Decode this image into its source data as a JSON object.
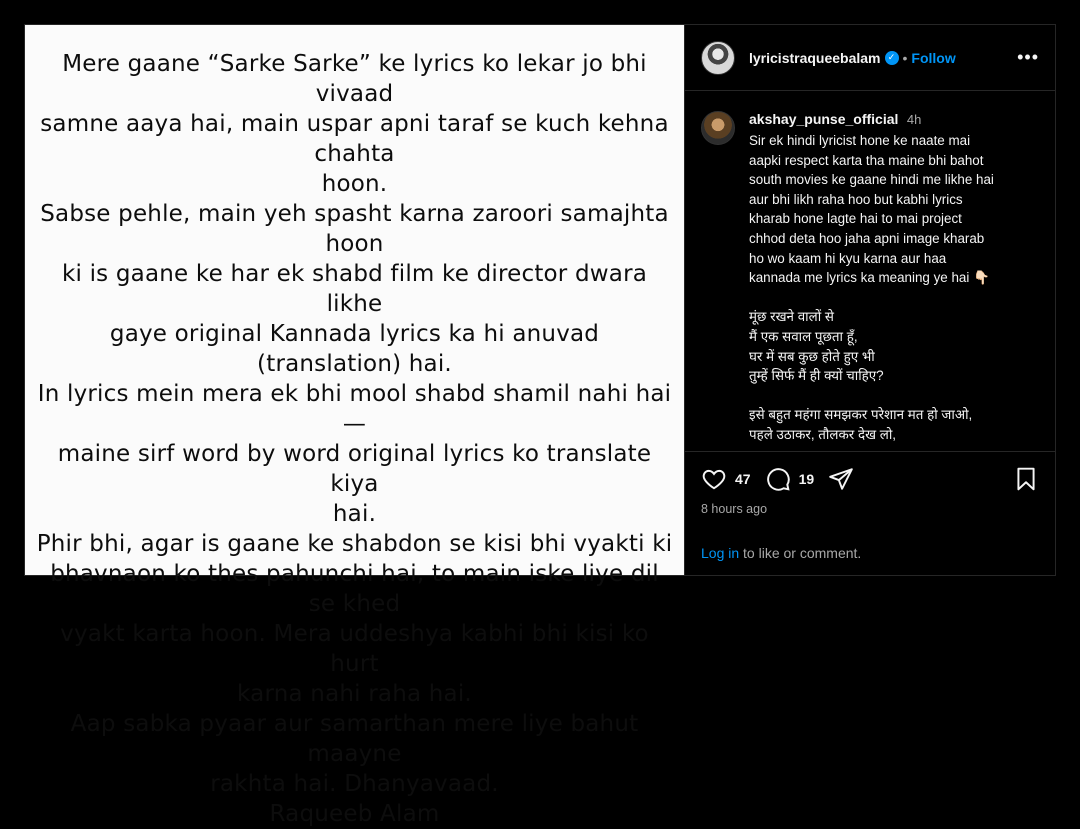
{
  "image_text": {
    "lines": [
      "Mere gaane “Sarke Sarke” ke lyrics ko lekar jo bhi vivaad",
      "samne aaya hai, main uspar apni taraf se kuch kehna chahta",
      "hoon.",
      "Sabse pehle, main yeh spasht karna zaroori samajhta hoon",
      "ki is gaane ke har ek shabd film ke director dwara likhe",
      "gaye original Kannada lyrics ka hi anuvad (translation) hai.",
      "In lyrics mein mera ek bhi mool shabd shamil nahi hai —",
      "maine sirf word by word original lyrics ko translate kiya",
      "hai.",
      "Phir bhi, agar is gaane ke shabdon se kisi bhi vyakti ki",
      "bhavnaon ko thes pahunchi hai, to main iske liye dil se khed",
      "vyakt karta hoon. Mera uddeshya kabhi bhi kisi ko hurt",
      "karna nahi raha hai.",
      "Aap sabka pyaar aur samarthan mere liye bahut maayne",
      "rakhta hai. Dhanyavaad.",
      "Raqueeb Alam"
    ]
  },
  "header": {
    "username": "lyricistraqueebalam",
    "dot": "•",
    "follow_label": "Follow",
    "more_label": "•••"
  },
  "comment": {
    "username": "akshay_punse_official",
    "time": "4h",
    "lines": [
      "Sir ek hindi lyricist hone ke naate mai",
      "aapki respect karta tha maine bhi bahot",
      "south movies ke gaane hindi me likhe hai",
      "aur bhi likh raha hoo but kabhi lyrics",
      "kharab hone lagte hai to mai project",
      "chhod deta hoo jaha apni image kharab",
      "ho wo kaam hi kyu karna aur haa",
      "kannada me lyrics ka meaning ye hai 👇🏻",
      "",
      "मूंछ रखने वालों से",
      "मैं एक सवाल पूछता हूँ,",
      "घर में सब कुछ होते हुए भी",
      "तुम्हें सिर्फ मैं ही क्यों चाहिए?",
      "",
      "इसे बहुत महंगा समझकर परेशान मत हो जाओ,",
      "पहले उठाकर, तौलकर देख लो,"
    ]
  },
  "actions": {
    "likes": "47",
    "comments": "19",
    "time_ago": "8 hours ago"
  },
  "login": {
    "link": "Log in",
    "rest": " to like or comment."
  },
  "colors": {
    "accent": "#0095f6",
    "background": "#000000",
    "text": "#f5f5f5",
    "muted": "#a8a8a8"
  }
}
